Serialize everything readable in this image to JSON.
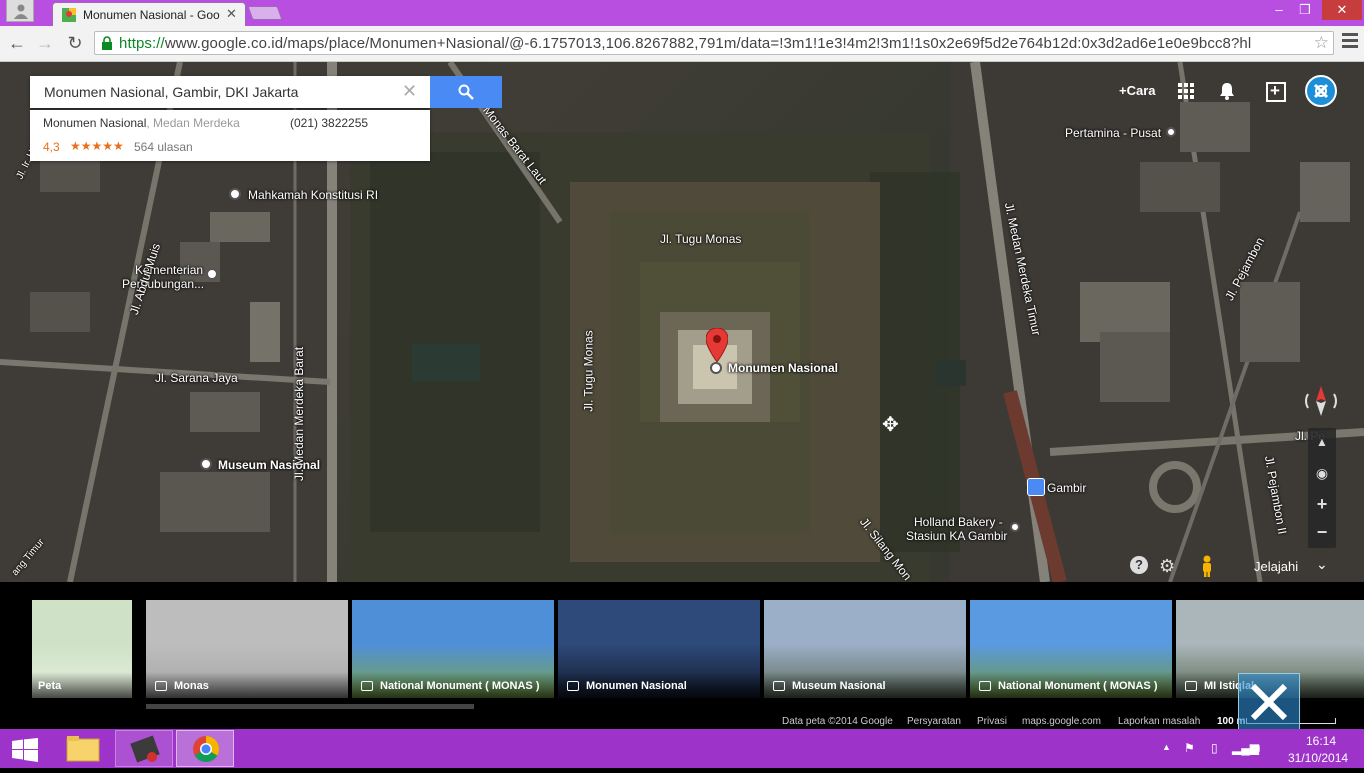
{
  "browser": {
    "tab_title": "Monumen Nasional - Goo",
    "url_scheme": "https://",
    "url_rest": "www.google.co.id/maps/place/Monumen+Nasional/@-6.1757013,106.8267882,791m/data=!3m1!1e3!4m2!3m1!1s0x2e69f5d2e764b12d:0x3d2ad6e1e0e9bcc8?hl"
  },
  "search": {
    "value": "Monumen Nasional, Gambir, DKI Jakarta"
  },
  "result": {
    "name": "Monumen Nasional",
    "sub": ", Medan Merdeka",
    "phone": "(021) 3822255",
    "rating": "4,3",
    "stars": "★★★★★",
    "reviews": "564 ulasan"
  },
  "topbar": {
    "directions": "+Cara"
  },
  "map_labels": {
    "marker": "Monumen Nasional",
    "pertamina": "Pertamina - Pusat",
    "mahkamah": "Mahkamah Konstitusi RI",
    "kementerian_1": "Kementerian",
    "kementerian_2": "Perhubungan...",
    "sarana_jaya": "Jl. Sarana Jaya",
    "museum": "Museum Nasional",
    "tugu_monas_top": "Jl. Tugu Monas",
    "tugu_monas_left": "Jl. Tugu Monas",
    "monas_barat_laut": "Jl. Monas Barat Laut",
    "medan_merdeka_barat": "Jl. Medan Merdeka Barat",
    "medan_merdeka_timur": "Jl. Medan Merdeka Timur",
    "abdul_muis": "Jl. Abdul Muis",
    "pejambon": "Jl. Pejambon",
    "pejambon_2": "Jl. Pejambon II",
    "pe": "Jl. Pe",
    "silang_monas": "Jl. Silang Mon",
    "gambir": "Gambir",
    "holland_1": "Holland Bakery -",
    "holland_2": "Stasiun KA Gambir",
    "ir_juanda": "Jl. Ir. H. Juanda",
    "timur": "ang Timur"
  },
  "controls": {
    "explore": "Jelajahi"
  },
  "photos": [
    {
      "caption": "Peta",
      "colors": [
        "#cfe2c7",
        "#e6efe0"
      ]
    },
    {
      "caption": "Monas",
      "colors": [
        "#bdbdbd",
        "#a6a6a6"
      ]
    },
    {
      "caption": "National Monument ( MONAS )",
      "colors": [
        "#4f8fd8",
        "#7ba54a"
      ]
    },
    {
      "caption": "Monumen Nasional",
      "colors": [
        "#2e4a7a",
        "#111a2c"
      ]
    },
    {
      "caption": "Museum Nasional",
      "colors": [
        "#9bb0c8",
        "#5c6a57"
      ]
    },
    {
      "caption": "National Monument ( MONAS )",
      "colors": [
        "#5a9ae0",
        "#6f9640"
      ]
    },
    {
      "caption": "MI Istiqlal",
      "colors": [
        "#aab6ba",
        "#5a6b55"
      ]
    }
  ],
  "footer": {
    "data": "Data peta ©2014 Google",
    "terms": "Persyaratan",
    "privacy": "Privasi",
    "site": "maps.google.com",
    "report": "Laporkan masalah",
    "scale": "100 m"
  },
  "taskbar": {
    "time": "16:14",
    "date": "31/10/2014"
  }
}
